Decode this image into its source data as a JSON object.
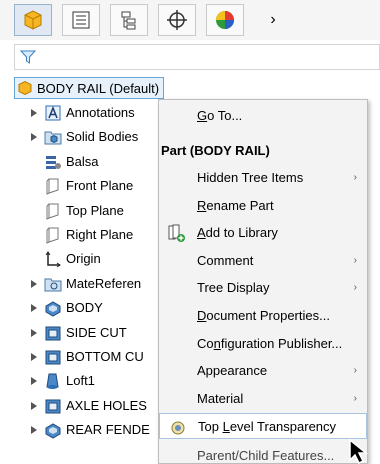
{
  "tree": {
    "root_label": "BODY RAIL (Default)",
    "items": [
      {
        "label": "Annotations",
        "caret": true,
        "icon": "annotations-icon"
      },
      {
        "label": "Solid Bodies",
        "caret": true,
        "icon": "solid-bodies-folder-icon"
      },
      {
        "label": "Balsa",
        "caret": false,
        "icon": "material-icon"
      },
      {
        "label": "Front Plane",
        "caret": false,
        "icon": "plane-icon"
      },
      {
        "label": "Top Plane",
        "caret": false,
        "icon": "plane-icon"
      },
      {
        "label": "Right Plane",
        "caret": false,
        "icon": "plane-icon"
      },
      {
        "label": "Origin",
        "caret": false,
        "icon": "origin-icon"
      },
      {
        "label": "MateReferen",
        "caret": true,
        "icon": "mate-reference-folder-icon"
      },
      {
        "label": "BODY",
        "caret": true,
        "icon": "feature-icon"
      },
      {
        "label": "SIDE CUT",
        "caret": true,
        "icon": "cut-feature-icon"
      },
      {
        "label": "BOTTOM CU",
        "caret": true,
        "icon": "cut-feature-icon"
      },
      {
        "label": "Loft1",
        "caret": true,
        "icon": "loft-icon"
      },
      {
        "label": "AXLE HOLES",
        "caret": true,
        "icon": "cut-feature-icon"
      },
      {
        "label": "REAR FENDE",
        "caret": true,
        "icon": "feature-icon"
      }
    ]
  },
  "menu": {
    "goto": {
      "pre": "",
      "u": "G",
      "post": "o To..."
    },
    "section_title": "Part (BODY RAIL)",
    "items": [
      {
        "pre": "Hidden Tree Items",
        "u": "",
        "post": "",
        "sub": true
      },
      {
        "pre": "",
        "u": "R",
        "post": "ename Part",
        "sub": false
      },
      {
        "pre": "",
        "u": "A",
        "post": "dd to Library",
        "sub": false
      },
      {
        "pre": "Comment",
        "u": "",
        "post": "",
        "sub": true
      },
      {
        "pre": "Tree Display",
        "u": "",
        "post": "",
        "sub": true
      },
      {
        "pre": "",
        "u": "D",
        "post": "ocument Properties...",
        "sub": false
      },
      {
        "pre": "Co",
        "u": "n",
        "post": "figuration Publisher...",
        "sub": false
      },
      {
        "pre": "Appearance",
        "u": "",
        "post": "",
        "sub": true
      },
      {
        "pre": "Material",
        "u": "",
        "post": "",
        "sub": true
      },
      {
        "pre": "Top ",
        "u": "L",
        "post": "evel Transparency",
        "sub": false
      }
    ],
    "cut_off_item": "Parent/Child Features..."
  },
  "colors": {
    "accent": "#2f6fb5",
    "highlight_border": "#a9c4e0",
    "menu_bg": "#f3f3f3"
  }
}
